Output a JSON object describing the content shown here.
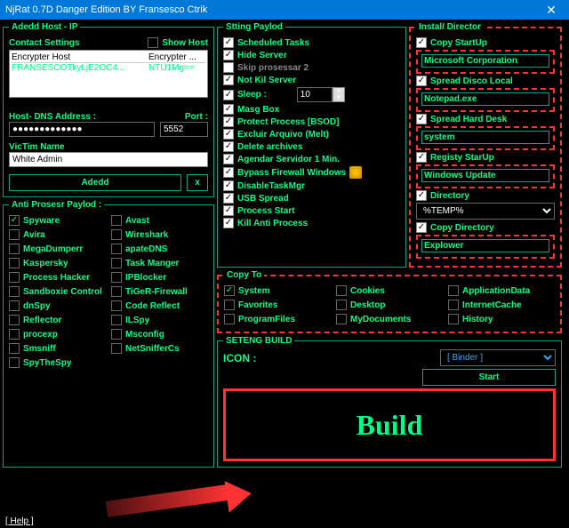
{
  "title": "NjRat 0.7D Danger Edition BY Fransesco Ctrik",
  "host": {
    "legend": "Adedd Host - IP",
    "contact": "Contact Settings",
    "showhost": "Show Host",
    "col1": "Encrypter Host",
    "col2": "Encrypter ...",
    "v1": "FRANSESCOTkyLjE2OC4...",
    "v2": "NTU1Mg==",
    "dnslbl": "Host- DNS Address :",
    "portlbl": "Port :",
    "dns": "●●●●●●●●●●●●●",
    "port": "5552",
    "victimlbl": "VicTim Name",
    "victim": "White Admin",
    "add": "Adedd",
    "x": "x"
  },
  "anti": {
    "legend": "Anti Prosesr Paylod :",
    "items": [
      "Spyware",
      "Avast",
      "Avira",
      "Wireshark",
      "MegaDumperr",
      "apateDNS",
      "Kaspersky",
      "Task Manger",
      "Process Hacker",
      "IPBlocker",
      "Sandboxie Control",
      "TiGeR-Firewall",
      "dnSpy",
      "Code Reflect",
      "Reflector",
      "ILSpy",
      "procexp",
      "Msconfig",
      "Smsniff",
      "NetSnifferCs",
      "SpyTheSpy"
    ]
  },
  "payload": {
    "legend": "Stting Paylod",
    "items": [
      "Scheduled Tasks",
      "Hide Server",
      "Skip prosessar 2",
      "Not Kil Server",
      "Sleep  :",
      "Masg Box",
      "Protect Process [BSOD]",
      "Excluir Arquivo (Melt)",
      "Delete archives",
      "Agendar Servidor 1 Min.",
      "Bypass Firewall Windows",
      "DisableTaskMgr",
      "USB Spread",
      "Process Start",
      "Kill Anti Process"
    ],
    "sleep": "10"
  },
  "install": {
    "legend": "Instal/ Director",
    "i1": "Copy StartUp",
    "h1": "Microsoft Corporation",
    "i2": "Spread Disco Local",
    "h2": "Notepad.exe",
    "i3": "Spread  Hard Desk",
    "h3": "system",
    "i4": "Registy StarUp",
    "h4": "Windows Update",
    "i5": "Directory",
    "sel": "%TEMP%",
    "i6": "Copy Directory",
    "h5": "Explower"
  },
  "copyto": {
    "legend": "Copy To",
    "items": [
      "System",
      "Cookies",
      "ApplicationData",
      "Favorites",
      "Desktop",
      "InternetCache",
      "ProgramFiles",
      "MyDocuments",
      "History"
    ]
  },
  "build": {
    "legend": "SETENG BUILD",
    "icon": "ICON :",
    "binder": "[ Binder ]",
    "start": "Start",
    "btn": "Build"
  },
  "help": "[ Help ]"
}
